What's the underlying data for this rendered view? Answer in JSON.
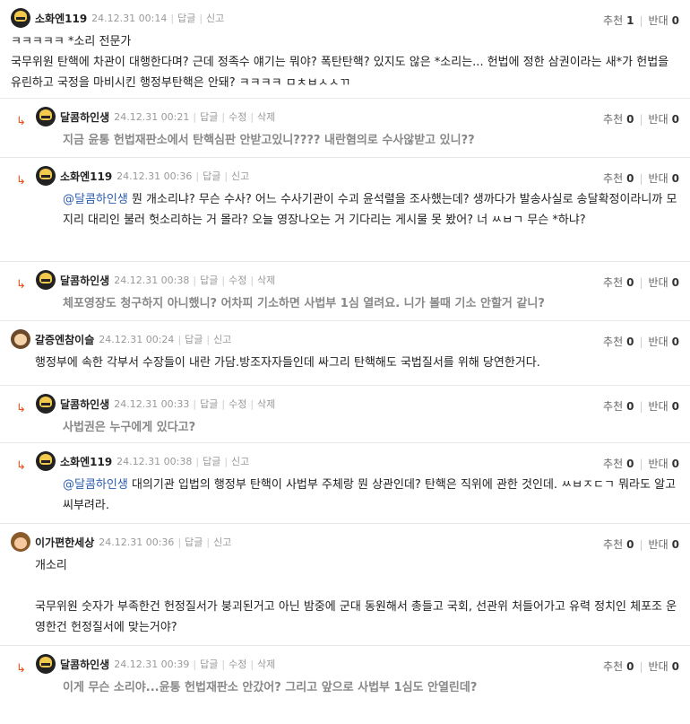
{
  "labels": {
    "reply": "답글",
    "report": "신고",
    "edit": "수정",
    "delete": "삭제",
    "up": "추천",
    "down": "반대"
  },
  "comments": [
    {
      "nick": "소화엔119",
      "time": "24.12.31 00:14",
      "up": "1",
      "down": "0",
      "text": "ㅋㅋㅋㅋㅋ *소리 전문가\n국무위원 탄핵에 차관이 대행한다며? 근데 정족수 얘기는 뭐야? 폭탄탄핵? 있지도 않은 *소리는... 헌법에 정한 삼권이라는 새*가 헌법을 유린하고 국정을 마비시킨 행정부탄핵은 안돼? ㅋㅋㅋㅋ ㅁㅊㅂㅅㅅㄲ"
    },
    {
      "nick": "달콤하인생",
      "time": "24.12.31 00:21",
      "up": "0",
      "down": "0",
      "text": "지금 윤통 헌법재판소에서 탄핵심판 안받고있니???? 내란혐의로 수사않받고 있니??"
    },
    {
      "nick": "소화엔119",
      "time": "24.12.31 00:36",
      "up": "0",
      "down": "0",
      "mention": "@달콤하인생",
      "text": " 뭔 개소리냐? 무슨 수사? 어느 수사기관이 수괴 윤석렬을 조사했는데? 생까다가 발송사실로 송달확정이라니까 모지리 대리인 불러 헛소리하는 거 몰라? 오늘 영장나오는 거 기다리는 게시물 못 봤어? 너 ㅆㅂㄱ 무슨 *하냐?"
    },
    {
      "nick": "달콤하인생",
      "time": "24.12.31 00:38",
      "up": "0",
      "down": "0",
      "text": "체포영장도 청구하지 아니했니? 어차피 기소하면 사법부 1심 열려요. 니가 볼때 기소 안할거 같니?"
    },
    {
      "nick": "갈증엔참이슬",
      "time": "24.12.31 00:24",
      "up": "0",
      "down": "0",
      "text": "행정부에 속한 각부서 수장들이 내란 가담.방조자자들인데 싸그리 탄핵해도 국법질서를 위해 당연한거다."
    },
    {
      "nick": "달콤하인생",
      "time": "24.12.31 00:33",
      "up": "0",
      "down": "0",
      "text": "사법권은 누구에게 있다고?"
    },
    {
      "nick": "소화엔119",
      "time": "24.12.31 00:38",
      "up": "0",
      "down": "0",
      "mention": "@달콤하인생",
      "text": " 대의기관 입법의 행정부 탄핵이 사법부 주체랑 뭔 상관인데? 탄핵은 직위에 관한 것인데. ㅆㅂㅈㄷㄱ 뭐라도 알고 씨부려라."
    },
    {
      "nick": "이가편한세상",
      "time": "24.12.31 00:36",
      "up": "0",
      "down": "0",
      "text": "개소리\n\n국무위원 숫자가 부족한건 헌정질서가 붕괴된거고 아닌 밤중에 군대 동원해서 총들고 국회, 선관위 처들어가고 유력 정치인 체포조 운영한건 헌정질서에 맞는거야?"
    },
    {
      "nick": "달콤하인생",
      "time": "24.12.31 00:39",
      "up": "0",
      "down": "0",
      "text": "이게 무슨 소리야...윤통 헌법재판소 안갔어? 그리고 앞으로 사법부 1심도 안열린데?"
    }
  ]
}
